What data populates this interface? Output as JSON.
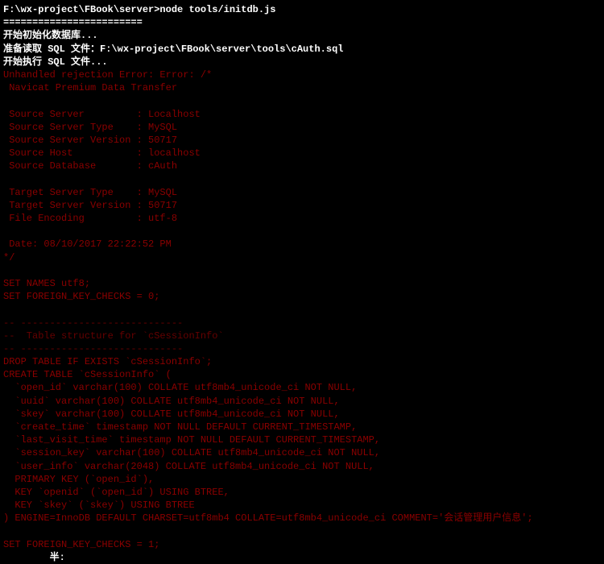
{
  "prompt": "F:\\wx-project\\FBook\\server>node tools/initdb.js",
  "hr": "========================",
  "init1": "开始初始化数据库...",
  "init2a": "准备读取 SQL 文件：",
  "init2b": "F:\\wx-project\\FBook\\server\\tools\\cAuth.sql",
  "init3": "开始执行 SQL 文件...",
  "err_header": "Unhandled rejection Error: Error: /*",
  "err_line2": " Navicat Premium Data Transfer",
  "meta": {
    "source_server": " Source Server         : Localhost",
    "source_server_type": " Source Server Type    : MySQL",
    "source_server_ver": " Source Server Version : 50717",
    "source_host": " Source Host           : localhost",
    "source_db": " Source Database       : cAuth",
    "target_server_type": " Target Server Type    : MySQL",
    "target_server_ver": " Target Server Version : 50717",
    "file_encoding": " File Encoding         : utf-8",
    "date": " Date: 08/10/2017 22:22:52 PM"
  },
  "close_comment": "*/",
  "set_names": "SET NAMES utf8;",
  "fk_off": "SET FOREIGN_KEY_CHECKS = 0;",
  "dash1": "-- ----------------------------",
  "dash2": "--  Table structure for `cSessionInfo`",
  "dash3": "-- ----------------------------",
  "drop": "DROP TABLE IF EXISTS `cSessionInfo`;",
  "create": "CREATE TABLE `cSessionInfo` (",
  "cols": [
    "  `open_id` varchar(100) COLLATE utf8mb4_unicode_ci NOT NULL,",
    "  `uuid` varchar(100) COLLATE utf8mb4_unicode_ci NOT NULL,",
    "  `skey` varchar(100) COLLATE utf8mb4_unicode_ci NOT NULL,",
    "  `create_time` timestamp NOT NULL DEFAULT CURRENT_TIMESTAMP,",
    "  `last_visit_time` timestamp NOT NULL DEFAULT CURRENT_TIMESTAMP,",
    "  `session_key` varchar(100) COLLATE utf8mb4_unicode_ci NOT NULL,",
    "  `user_info` varchar(2048) COLLATE utf8mb4_unicode_ci NOT NULL,",
    "  PRIMARY KEY (`open_id`),",
    "  KEY `openid` (`open_id`) USING BTREE,",
    "  KEY `skey` (`skey`) USING BTREE"
  ],
  "engine": ") ENGINE=InnoDB DEFAULT CHARSET=utf8mb4 COLLATE=utf8mb4_unicode_ci COMMENT='会话管理用户信息';",
  "fk_on": "SET FOREIGN_KEY_CHECKS = 1;",
  "trailing": "        半:"
}
